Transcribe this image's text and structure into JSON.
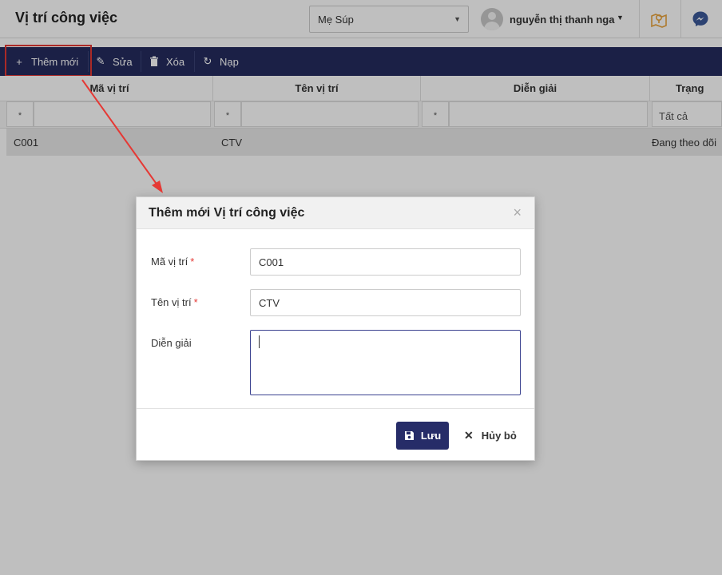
{
  "header": {
    "title": "Vị trí công việc",
    "org_select": "Mẹ Súp",
    "user_name": "nguyễn thị thanh nga"
  },
  "toolbar": {
    "add_label": "Thêm mới",
    "edit_label": "Sửa",
    "delete_label": "Xóa",
    "reload_label": "Nạp"
  },
  "grid": {
    "columns": [
      "Mã vị trí",
      "Tên vị trí",
      "Diễn giải",
      "Trạng"
    ],
    "filters": {
      "op": "*",
      "status": "Tất cả"
    },
    "rows": [
      {
        "code": "C001",
        "name": "CTV",
        "description": "",
        "status": "Đang theo dõi"
      }
    ]
  },
  "dialog": {
    "title": "Thêm mới Vị trí công việc",
    "close": "×",
    "fields": {
      "code_label": "Mã vị trí",
      "code_value": "C001",
      "name_label": "Tên vị trí",
      "name_value": "CTV",
      "desc_label": "Diễn giải",
      "desc_value": "",
      "required_mark": "*"
    },
    "save_label": "Lưu",
    "cancel_label": "Hủy bỏ"
  },
  "colors": {
    "toolbar": "#242b5e",
    "save_button": "#262c68",
    "highlight": "#e53935",
    "icon_accent": "#e8a33d",
    "messenger": "#3b5998"
  }
}
